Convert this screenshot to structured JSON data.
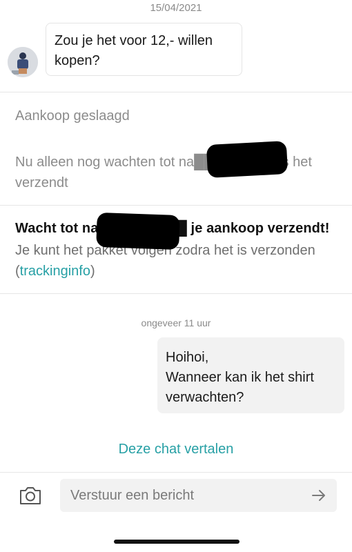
{
  "header": {
    "date": "15/04/2021"
  },
  "incoming_message": {
    "text": "Zou je het voor 12,- willen kopen?"
  },
  "purchase_status": {
    "title": "Aankoop geslaagd",
    "subtitle": "Nu alleen nog wachten tot na█████████s het verzendt"
  },
  "shipping_notice": {
    "title": "Wacht tot na█████████ je aankoop verzendt!",
    "body_prefix": "Je kunt het pakket volgen zodra het is verzonden (",
    "link": "trackinginfo",
    "body_suffix": ")"
  },
  "conversation": {
    "timestamp": "ongeveer 11 uur",
    "outgoing_message": "Hoihoi,\nWanneer kan ik het shirt verwachten?"
  },
  "translate_link": "Deze chat vertalen",
  "composer": {
    "placeholder": "Verstuur een bericht",
    "camera_icon": "camera-icon",
    "send_icon": "arrow-right-icon"
  },
  "colors": {
    "accent": "#27a0a5"
  }
}
